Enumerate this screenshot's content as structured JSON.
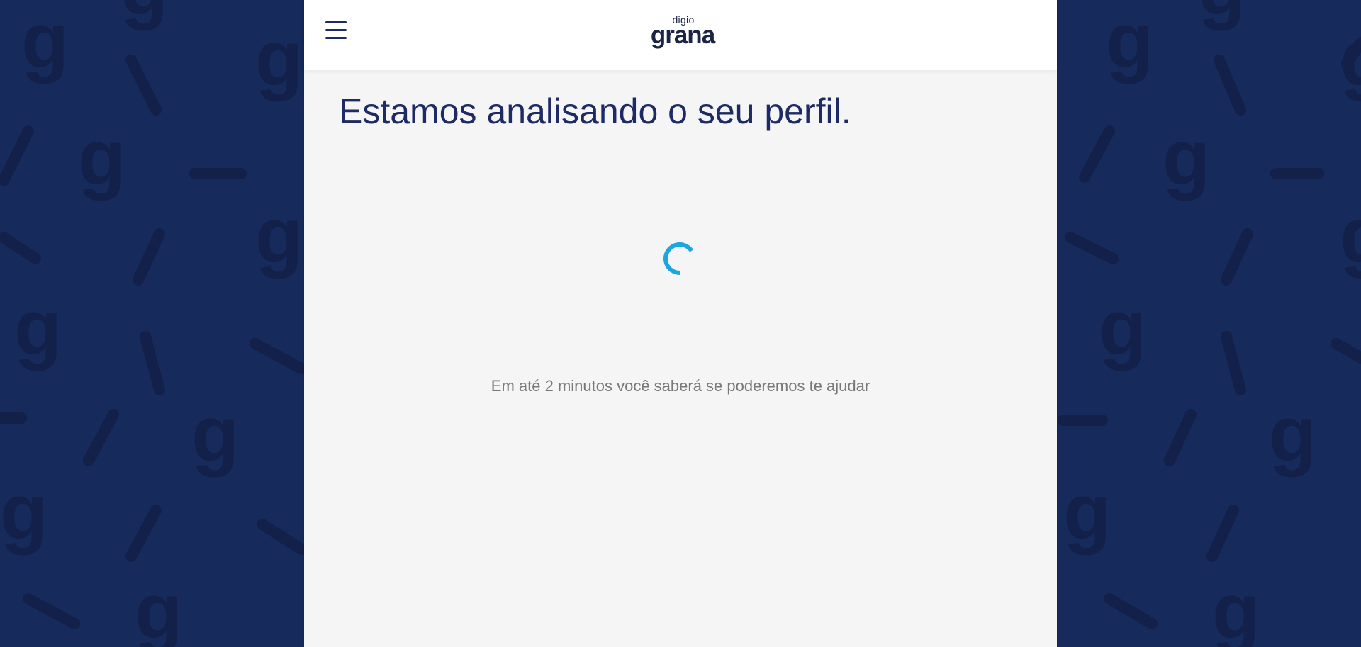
{
  "background": {
    "color": "#172a5c",
    "pattern_color": "#13204a"
  },
  "header": {
    "menu_icon": "hamburger-menu-icon",
    "logo": {
      "small": "digio",
      "main": "grana"
    }
  },
  "main": {
    "title": "Estamos analisando o seu perfil.",
    "loading_icon": "loading-spinner-icon",
    "message": "Em até 2 minutos você saberá se poderemos te ajudar"
  },
  "colors": {
    "brand_navy": "#1e2a63",
    "spinner_blue": "#1aa6e0",
    "text_gray": "#787878",
    "panel_bg": "#f5f5f6"
  }
}
